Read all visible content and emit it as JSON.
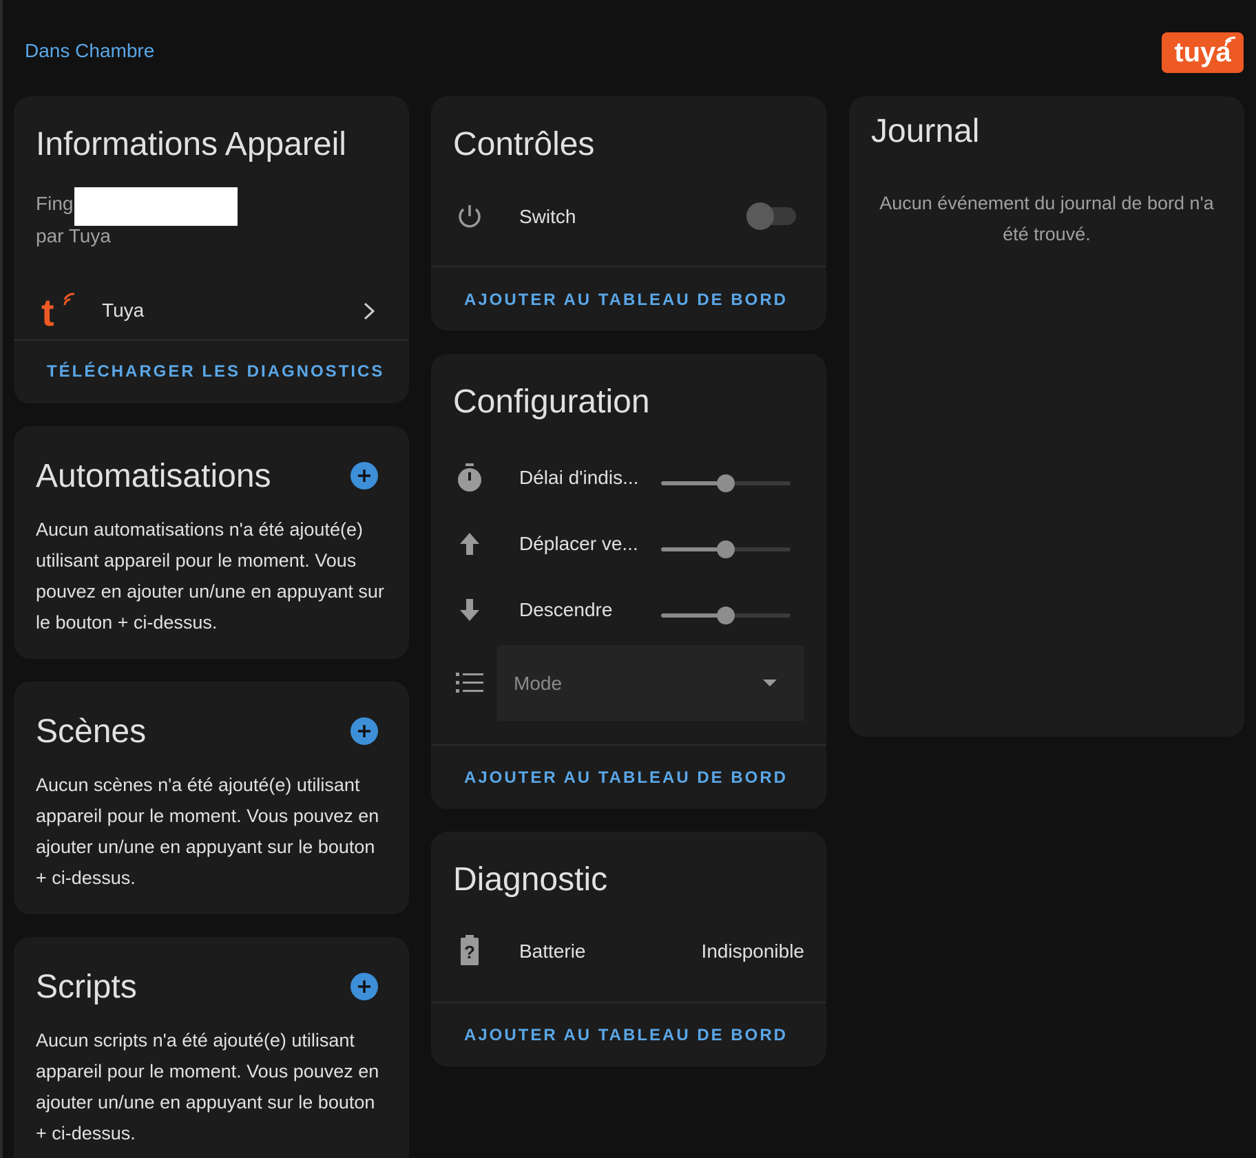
{
  "breadcrumb": {
    "area": "Dans Chambre"
  },
  "brand": {
    "logo_text": "tuya",
    "accent": "#ee5a24",
    "link_color": "#5aa7e8"
  },
  "device_info": {
    "title": "Informations Appareil",
    "model_partial": "Fing",
    "manufacturer": "par Tuya",
    "integration_name": "Tuya",
    "download_diagnostics": "TÉLÉCHARGER LES DIAGNOSTICS"
  },
  "automations": {
    "title": "Automatisations",
    "empty_text": "Aucun automatisations n'a été ajouté(e) utilisant appareil pour le moment. Vous pouvez en ajouter un/une en appuyant sur le bouton + ci-dessus."
  },
  "scenes": {
    "title": "Scènes",
    "empty_text": "Aucun scènes n'a été ajouté(e) utilisant appareil pour le moment. Vous pouvez en ajouter un/une en appuyant sur le bouton + ci-dessus."
  },
  "scripts": {
    "title": "Scripts",
    "empty_text": "Aucun scripts n'a été ajouté(e) utilisant appareil pour le moment. Vous pouvez en ajouter un/une en appuyant sur le bouton + ci-dessus."
  },
  "controls": {
    "title": "Contrôles",
    "switch_label": "Switch",
    "switch_on": false,
    "add_to_dashboard": "AJOUTER AU TABLEAU DE BORD"
  },
  "configuration": {
    "title": "Configuration",
    "sliders": [
      {
        "label": "Délai d'indis...",
        "icon": "timer-icon",
        "value_fraction": 0.5
      },
      {
        "label": "Déplacer ve...",
        "icon": "arrow-up-icon",
        "value_fraction": 0.5
      },
      {
        "label": "Descendre",
        "icon": "arrow-down-icon",
        "value_fraction": 0.5
      }
    ],
    "mode_placeholder": "Mode",
    "add_to_dashboard": "AJOUTER AU TABLEAU DE BORD"
  },
  "diagnostic": {
    "title": "Diagnostic",
    "battery_label": "Batterie",
    "battery_value": "Indisponible",
    "add_to_dashboard": "AJOUTER AU TABLEAU DE BORD"
  },
  "journal": {
    "title": "Journal",
    "empty_text": "Aucun événement du journal de bord n'a été trouvé."
  }
}
